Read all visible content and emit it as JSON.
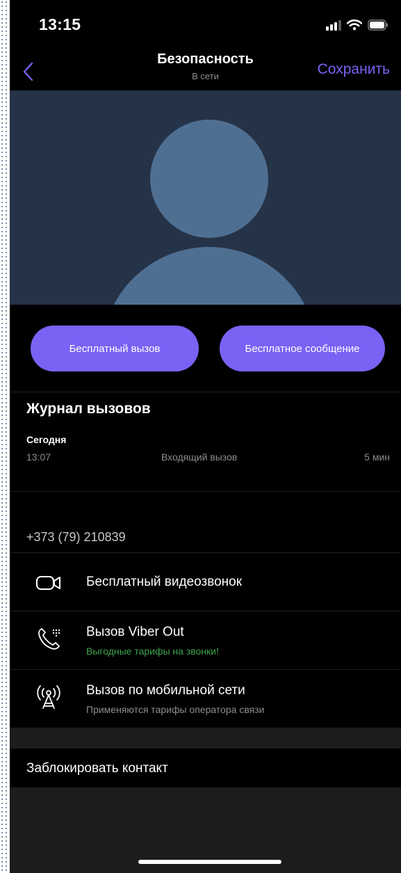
{
  "status_bar": {
    "time": "13:15"
  },
  "nav": {
    "title": "Безопасность",
    "subtitle": "В сети",
    "save_label": "Сохранить"
  },
  "actions": {
    "free_call_label": "Бесплатный вызов",
    "free_message_label": "Бесплатное сообщение"
  },
  "call_log": {
    "title": "Журнал вызовов",
    "day": "Сегодня",
    "entries": [
      {
        "time": "13:07",
        "type": "Входящий вызов",
        "duration": "5 мин"
      }
    ]
  },
  "contact": {
    "phone": "+373 (79) 210839",
    "options": [
      {
        "label": "Бесплатный видеозвонок",
        "subtitle": "",
        "icon": "video-camera-icon"
      },
      {
        "label": "Вызов Viber Out",
        "subtitle": "Выгодные тарифы на звонки!",
        "icon": "viber-out-phone-icon"
      },
      {
        "label": "Вызов по мобильной сети",
        "subtitle": "Применяются тарифы оператора связи",
        "icon": "cell-tower-icon"
      }
    ],
    "block_label": "Заблокировать контакт"
  },
  "colors": {
    "accent": "#7b61f4",
    "promo_green": "#3fa34d",
    "hero_background": "#253348",
    "avatar_placeholder": "#4f6f92",
    "background": "#000000"
  }
}
